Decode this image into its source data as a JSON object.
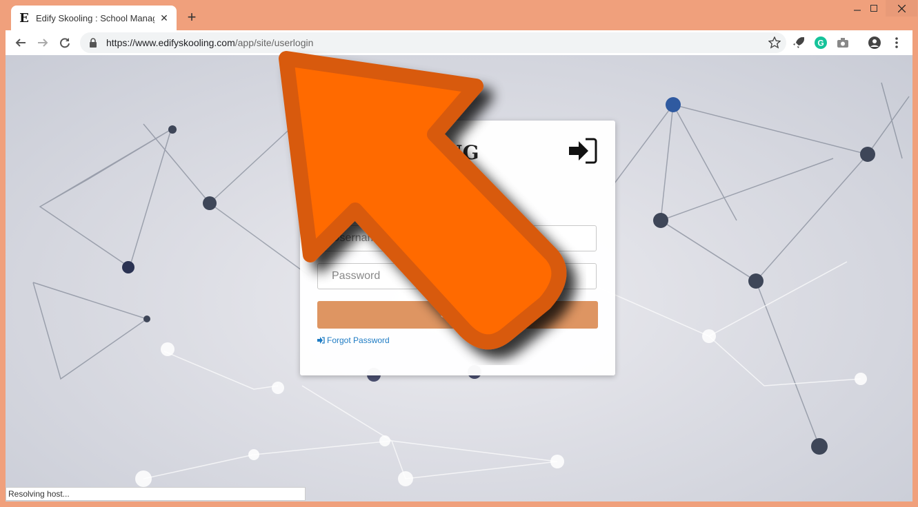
{
  "browser": {
    "tab": {
      "favicon_letter": "E",
      "title": "Edify Skooling : School Managem"
    },
    "url": {
      "host": "https://www.edifyskooling.com",
      "path": "/app/site/userlogin"
    },
    "status_text": "Resolving host..."
  },
  "login": {
    "logo_partial": "NG",
    "username_placeholder": "Username",
    "password_placeholder": "Password",
    "signin_label": "Sign In",
    "forgot_label": "Forgot Password"
  },
  "colors": {
    "window_frame": "#f0a07c",
    "signin_button": "#de9562",
    "link": "#1f7cc4",
    "arrow_fill": "#ff6a00",
    "arrow_stroke": "#d85a10"
  },
  "icons": [
    "back-icon",
    "forward-icon",
    "reload-icon",
    "lock-icon",
    "star-icon",
    "rocket-extension-icon",
    "grammarly-icon",
    "camera-extension-icon",
    "profile-icon",
    "menu-icon",
    "login-icon",
    "sign-in-icon",
    "orange-arrow-icon"
  ]
}
